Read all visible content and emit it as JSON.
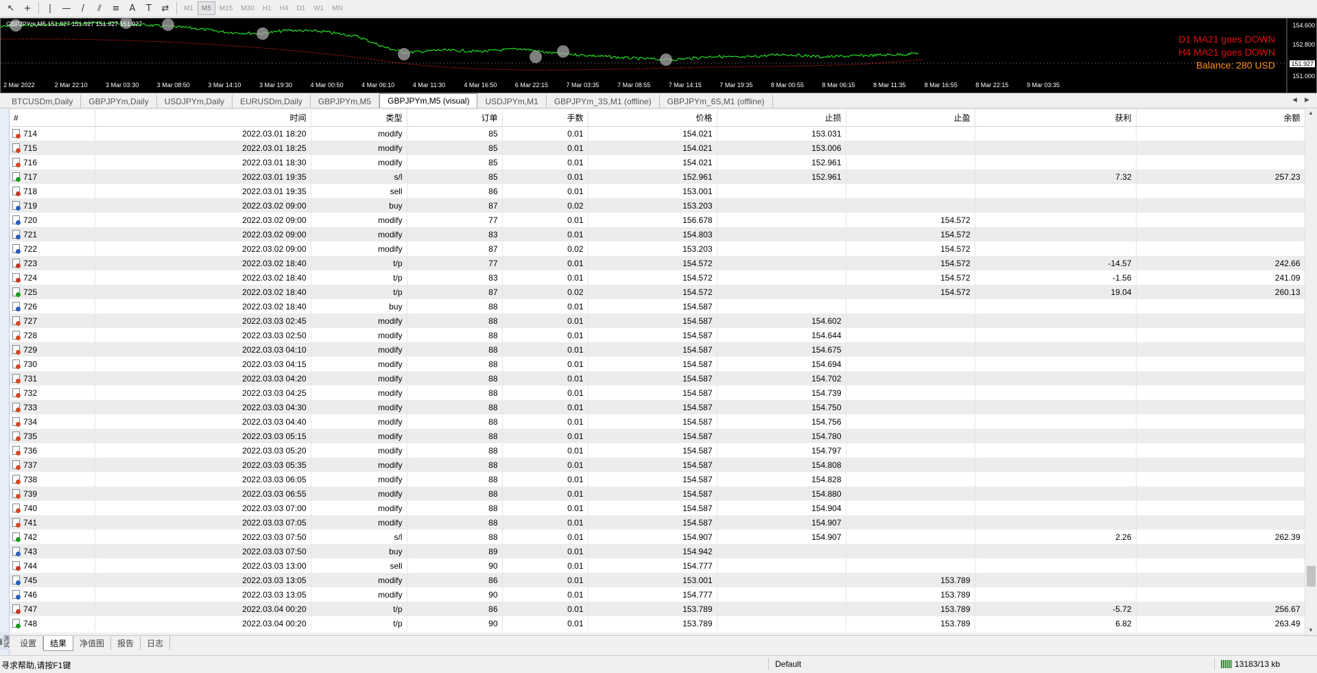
{
  "toolbar": {
    "timeframes": [
      "M1",
      "M5",
      "M15",
      "M30",
      "H1",
      "H4",
      "D1",
      "W1",
      "MN"
    ],
    "active_timeframe": "M5"
  },
  "chart": {
    "symbol_line": "GBPJPYm,M5  151.927 151.927 151.927 151.927",
    "message_d1": "D1 MA21 goes DOWN",
    "message_h4": "H4 MA21 goes DOWN",
    "balance": "Balance: 280 USD",
    "y_labels": [
      "154.600",
      "152.800",
      "151.927",
      "151.000"
    ],
    "x_labels": [
      "2 Mar 2022",
      "2 Mar 22:10",
      "3 Mar 03:30",
      "3 Mar 08:50",
      "3 Mar 14:10",
      "3 Mar 19:30",
      "4 Mar 00:50",
      "4 Mar 06:10",
      "4 Mar 11:30",
      "4 Mar 16:50",
      "6 Mar 22:15",
      "7 Mar 03:35",
      "7 Mar 08:55",
      "7 Mar 14:15",
      "7 Mar 19:35",
      "8 Mar 00:55",
      "8 Mar 06:15",
      "8 Mar 11:35",
      "8 Mar 16:55",
      "8 Mar 22:15",
      "9 Mar 03:35"
    ],
    "colors": {
      "price": "#22dd22",
      "ma": "#cc2020",
      "msg": "#e01010",
      "balance": "#ff8c1a"
    }
  },
  "chart_tabs": [
    {
      "label": "BTCUSDm,Daily",
      "active": false
    },
    {
      "label": "GBPJPYm,Daily",
      "active": false
    },
    {
      "label": "USDJPYm,Daily",
      "active": false
    },
    {
      "label": "EURUSDm,Daily",
      "active": false
    },
    {
      "label": "GBPJPYm,M5",
      "active": false
    },
    {
      "label": "GBPJPYm,M5 (visual)",
      "active": true
    },
    {
      "label": "USDJPYm,M1",
      "active": false
    },
    {
      "label": "GBPJPYm_3S,M1 (offline)",
      "active": false
    },
    {
      "label": "GBPJPYm_6S,M1 (offline)",
      "active": false
    }
  ],
  "table": {
    "columns": [
      "#",
      "时间",
      "类型",
      "订单",
      "手数",
      "价格",
      "止损",
      "止盈",
      "获利",
      "余额"
    ],
    "rows": [
      [
        "714",
        "2022.03.01 18:20",
        "modify",
        "85",
        "0.01",
        "154.021",
        "153.031",
        "",
        "",
        ""
      ],
      [
        "715",
        "2022.03.01 18:25",
        "modify",
        "85",
        "0.01",
        "154.021",
        "153.006",
        "",
        "",
        ""
      ],
      [
        "716",
        "2022.03.01 18:30",
        "modify",
        "85",
        "0.01",
        "154.021",
        "152.961",
        "",
        "",
        ""
      ],
      [
        "717",
        "2022.03.01 19:35",
        "s/l",
        "85",
        "0.01",
        "152.961",
        "152.961",
        "",
        "7.32",
        "257.23"
      ],
      [
        "718",
        "2022.03.01 19:35",
        "sell",
        "86",
        "0.01",
        "153.001",
        "",
        "",
        "",
        ""
      ],
      [
        "719",
        "2022.03.02 09:00",
        "buy",
        "87",
        "0.02",
        "153.203",
        "",
        "",
        "",
        ""
      ],
      [
        "720",
        "2022.03.02 09:00",
        "modify",
        "77",
        "0.01",
        "156.678",
        "",
        "154.572",
        "",
        ""
      ],
      [
        "721",
        "2022.03.02 09:00",
        "modify",
        "83",
        "0.01",
        "154.803",
        "",
        "154.572",
        "",
        ""
      ],
      [
        "722",
        "2022.03.02 09:00",
        "modify",
        "87",
        "0.02",
        "153.203",
        "",
        "154.572",
        "",
        ""
      ],
      [
        "723",
        "2022.03.02 18:40",
        "t/p",
        "77",
        "0.01",
        "154.572",
        "",
        "154.572",
        "-14.57",
        "242.66"
      ],
      [
        "724",
        "2022.03.02 18:40",
        "t/p",
        "83",
        "0.01",
        "154.572",
        "",
        "154.572",
        "-1.56",
        "241.09"
      ],
      [
        "725",
        "2022.03.02 18:40",
        "t/p",
        "87",
        "0.02",
        "154.572",
        "",
        "154.572",
        "19.04",
        "260.13"
      ],
      [
        "726",
        "2022.03.02 18:40",
        "buy",
        "88",
        "0.01",
        "154.587",
        "",
        "",
        "",
        ""
      ],
      [
        "727",
        "2022.03.03 02:45",
        "modify",
        "88",
        "0.01",
        "154.587",
        "154.602",
        "",
        "",
        ""
      ],
      [
        "728",
        "2022.03.03 02:50",
        "modify",
        "88",
        "0.01",
        "154.587",
        "154.644",
        "",
        "",
        ""
      ],
      [
        "729",
        "2022.03.03 04:10",
        "modify",
        "88",
        "0.01",
        "154.587",
        "154.675",
        "",
        "",
        ""
      ],
      [
        "730",
        "2022.03.03 04:15",
        "modify",
        "88",
        "0.01",
        "154.587",
        "154.694",
        "",
        "",
        ""
      ],
      [
        "731",
        "2022.03.03 04:20",
        "modify",
        "88",
        "0.01",
        "154.587",
        "154.702",
        "",
        "",
        ""
      ],
      [
        "732",
        "2022.03.03 04:25",
        "modify",
        "88",
        "0.01",
        "154.587",
        "154.739",
        "",
        "",
        ""
      ],
      [
        "733",
        "2022.03.03 04:30",
        "modify",
        "88",
        "0.01",
        "154.587",
        "154.750",
        "",
        "",
        ""
      ],
      [
        "734",
        "2022.03.03 04:40",
        "modify",
        "88",
        "0.01",
        "154.587",
        "154.756",
        "",
        "",
        ""
      ],
      [
        "735",
        "2022.03.03 05:15",
        "modify",
        "88",
        "0.01",
        "154.587",
        "154.780",
        "",
        "",
        ""
      ],
      [
        "736",
        "2022.03.03 05:20",
        "modify",
        "88",
        "0.01",
        "154.587",
        "154.797",
        "",
        "",
        ""
      ],
      [
        "737",
        "2022.03.03 05:35",
        "modify",
        "88",
        "0.01",
        "154.587",
        "154.808",
        "",
        "",
        ""
      ],
      [
        "738",
        "2022.03.03 06:05",
        "modify",
        "88",
        "0.01",
        "154.587",
        "154.828",
        "",
        "",
        ""
      ],
      [
        "739",
        "2022.03.03 06:55",
        "modify",
        "88",
        "0.01",
        "154.587",
        "154.880",
        "",
        "",
        ""
      ],
      [
        "740",
        "2022.03.03 07:00",
        "modify",
        "88",
        "0.01",
        "154.587",
        "154.904",
        "",
        "",
        ""
      ],
      [
        "741",
        "2022.03.03 07:05",
        "modify",
        "88",
        "0.01",
        "154.587",
        "154.907",
        "",
        "",
        ""
      ],
      [
        "742",
        "2022.03.03 07:50",
        "s/l",
        "88",
        "0.01",
        "154.907",
        "154.907",
        "",
        "2.26",
        "262.39"
      ],
      [
        "743",
        "2022.03.03 07:50",
        "buy",
        "89",
        "0.01",
        "154.942",
        "",
        "",
        "",
        ""
      ],
      [
        "744",
        "2022.03.03 13:00",
        "sell",
        "90",
        "0.01",
        "154.777",
        "",
        "",
        "",
        ""
      ],
      [
        "745",
        "2022.03.03 13:05",
        "modify",
        "86",
        "0.01",
        "153.001",
        "",
        "153.789",
        "",
        ""
      ],
      [
        "746",
        "2022.03.03 13:05",
        "modify",
        "90",
        "0.01",
        "154.777",
        "",
        "153.789",
        "",
        ""
      ],
      [
        "747",
        "2022.03.04 00:20",
        "t/p",
        "86",
        "0.01",
        "153.789",
        "",
        "153.789",
        "-5.72",
        "256.67"
      ],
      [
        "748",
        "2022.03.04 00:20",
        "t/p",
        "90",
        "0.01",
        "153.789",
        "",
        "153.789",
        "6.82",
        "263.49"
      ]
    ]
  },
  "bottom_tabs": [
    {
      "label": "设置",
      "active": false
    },
    {
      "label": "结果",
      "active": true
    },
    {
      "label": "净值图",
      "active": false
    },
    {
      "label": "报告",
      "active": false
    },
    {
      "label": "日志",
      "active": false
    }
  ],
  "side_label": "测试器",
  "status": {
    "help": "寻求帮助,请按F1键",
    "profile": "Default",
    "traffic": "13183/13 kb"
  }
}
